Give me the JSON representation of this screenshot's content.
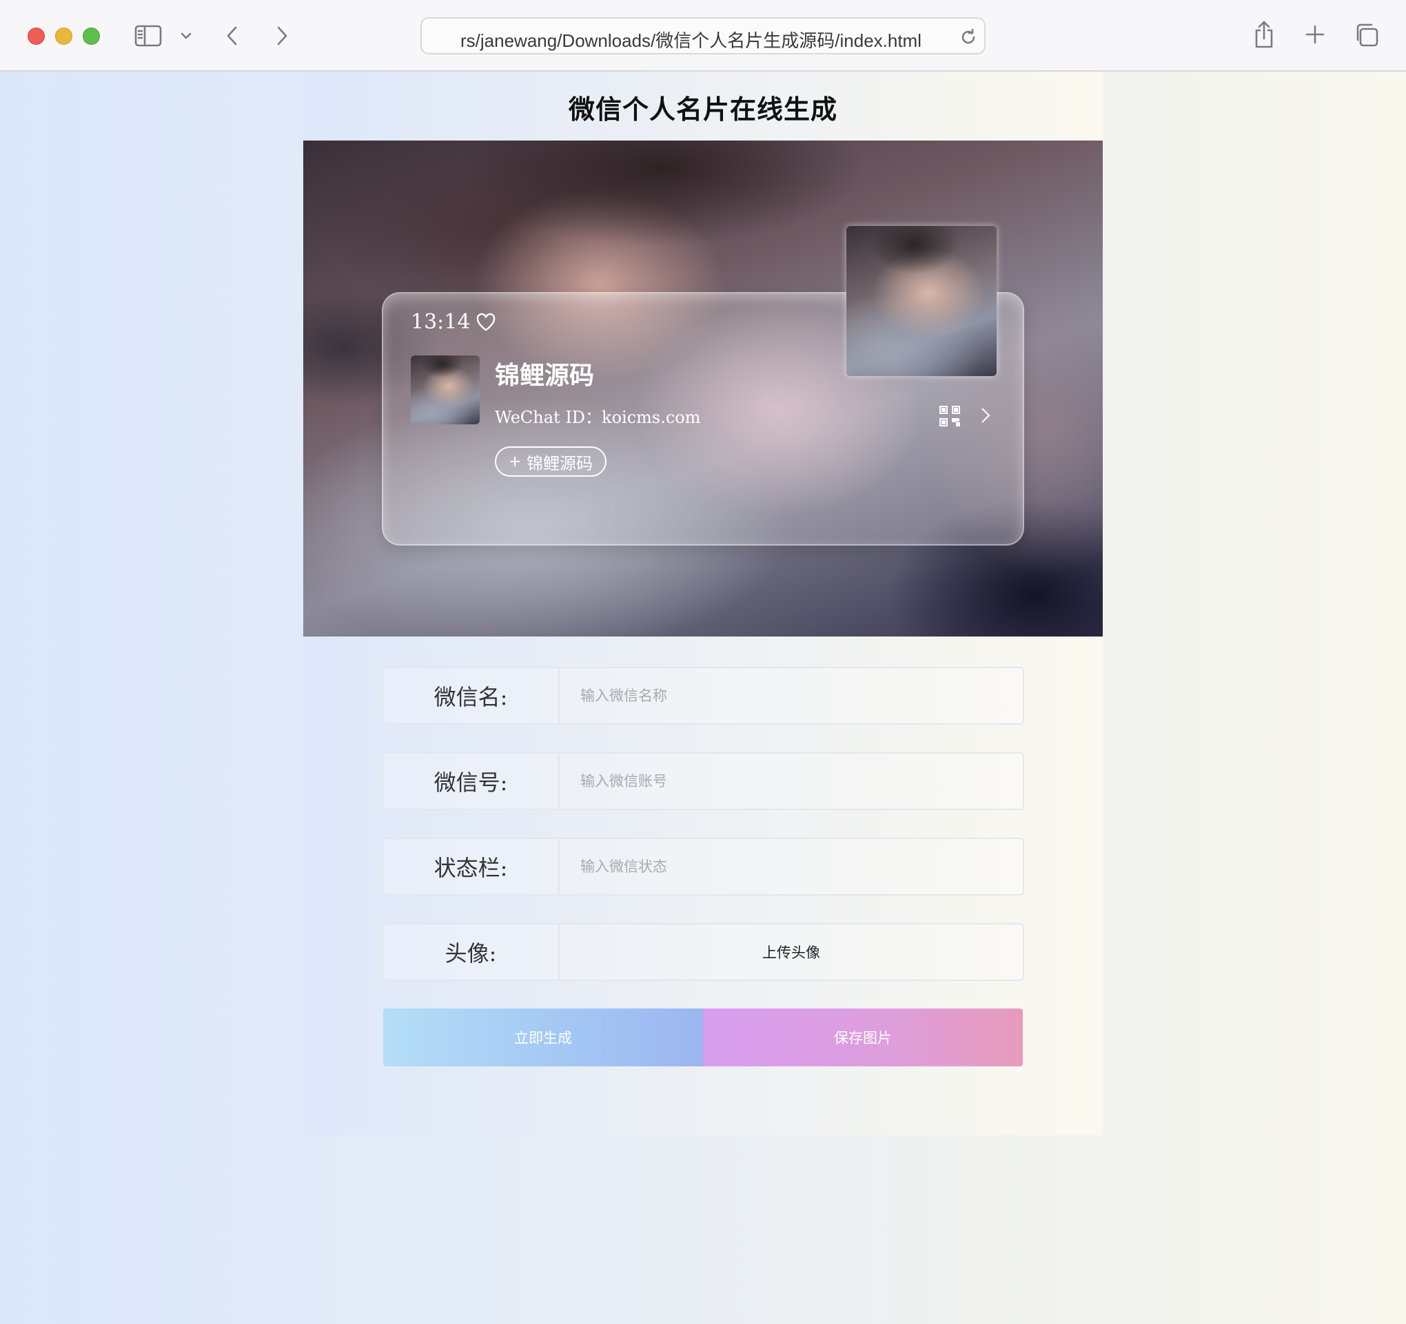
{
  "browser": {
    "url": "rs/janewang/Downloads/微信个人名片生成源码/index.html"
  },
  "page": {
    "title": "微信个人名片在线生成"
  },
  "card": {
    "status": "13:14",
    "nickname": "锦鲤源码",
    "wechat_id": "WeChat ID：koicms.com",
    "add_label": "锦鲤源码"
  },
  "form": {
    "name_label": "微信名:",
    "name_placeholder": "输入微信名称",
    "id_label": "微信号:",
    "id_placeholder": "输入微信账号",
    "status_label": "状态栏:",
    "status_placeholder": "输入微信状态",
    "avatar_label": "头像:",
    "upload_label": "上传头像"
  },
  "actions": {
    "generate_label": "立即生成",
    "save_label": "保存图片"
  },
  "colors": {
    "generate_gradient_start": "#b4def7",
    "save_gradient_end": "#e79bbb"
  }
}
